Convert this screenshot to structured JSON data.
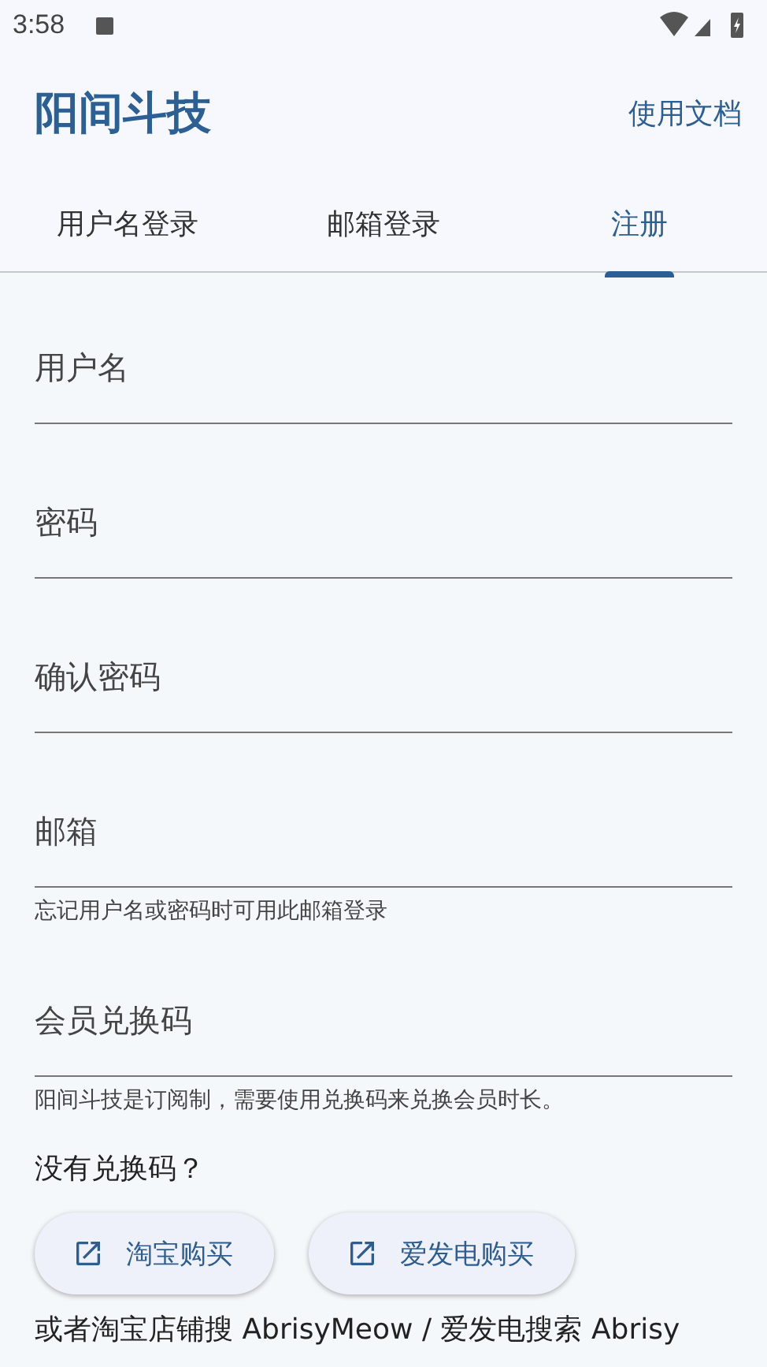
{
  "status_bar": {
    "time": "3:58"
  },
  "app_bar": {
    "title": "阳间斗技",
    "action": "使用文档"
  },
  "tabs": [
    {
      "label": "用户名登录",
      "selected": false
    },
    {
      "label": "邮箱登录",
      "selected": false
    },
    {
      "label": "注册",
      "selected": true
    }
  ],
  "fields": [
    {
      "placeholder": "用户名"
    },
    {
      "placeholder": "密码"
    },
    {
      "placeholder": "确认密码"
    },
    {
      "placeholder": "邮箱",
      "helper": "忘记用户名或密码时可用此邮箱登录"
    },
    {
      "placeholder": "会员兑换码",
      "helper": "阳间斗技是订阅制，需要使用兑换码来兑换会员时长。"
    }
  ],
  "purchase": {
    "question": "没有兑换码？",
    "buttons": [
      {
        "label": "淘宝购买"
      },
      {
        "label": "爱发电购买"
      }
    ],
    "note": "或者淘宝店铺搜 AbrisyMeow / 爱发电搜索 Abrisy"
  }
}
